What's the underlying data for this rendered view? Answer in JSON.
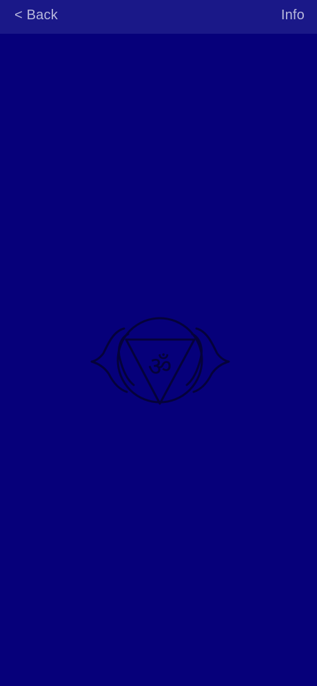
{
  "nav": {
    "back_label": "< Back",
    "info_label": "Info"
  },
  "symbol": {
    "name": "third-eye-chakra-symbol",
    "glyph": "ॐ",
    "stroke_color": "#05023A"
  },
  "colors": {
    "background": "#06007A",
    "nav_background": "#1A1888",
    "nav_text": "#B9B9DD"
  }
}
